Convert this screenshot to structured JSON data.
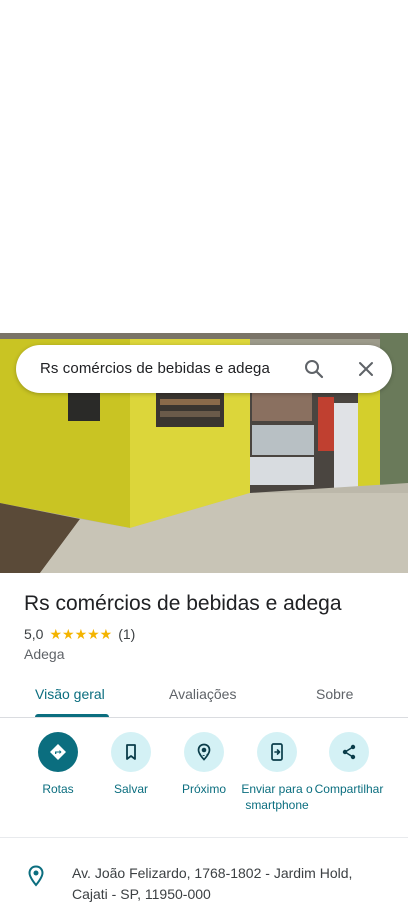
{
  "search": {
    "query": "Rs comércios de bebidas e adega"
  },
  "place": {
    "title": "Rs comércios de bebidas e adega",
    "rating": "5,0",
    "stars": "★★★★★",
    "review_count": "(1)",
    "category": "Adega",
    "address": "Av. João Felizardo, 1768-1802 - Jardim Hold, Cajati - SP, 11950-000"
  },
  "tabs": [
    {
      "label": "Visão geral",
      "active": true
    },
    {
      "label": "Avaliações",
      "active": false
    },
    {
      "label": "Sobre",
      "active": false
    }
  ],
  "actions": [
    {
      "label": "Rotas",
      "icon": "directions-icon"
    },
    {
      "label": "Salvar",
      "icon": "bookmark-icon"
    },
    {
      "label": "Próximo",
      "icon": "nearby-icon"
    },
    {
      "label": "Enviar para o smartphone",
      "icon": "send-to-phone-icon"
    },
    {
      "label": "Compartilhar",
      "icon": "share-icon"
    }
  ],
  "colors": {
    "accent": "#0b6e7f",
    "accent_light": "#d4f1f5",
    "stars": "#f4b400"
  }
}
